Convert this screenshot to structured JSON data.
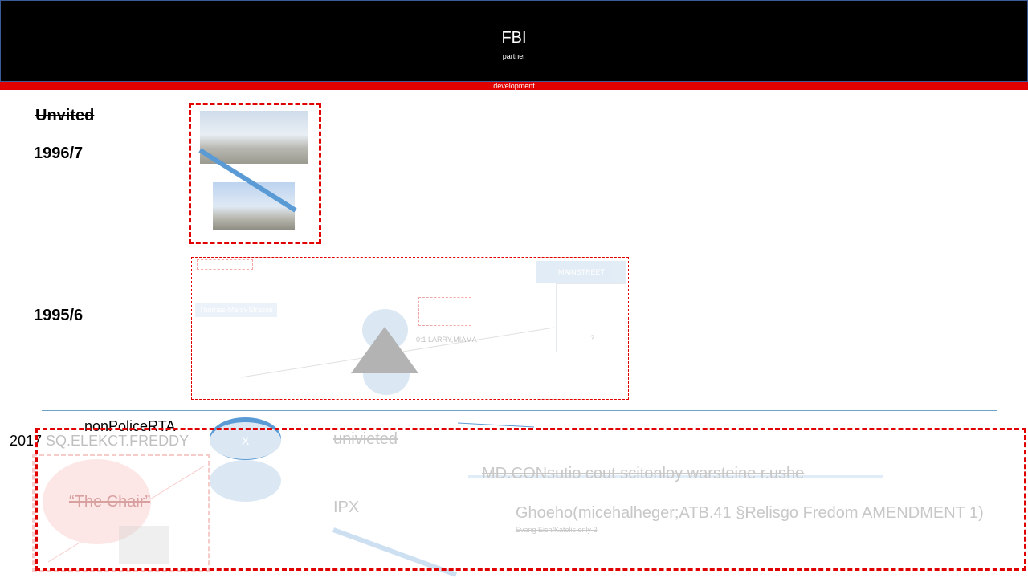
{
  "header": {
    "title": "FBI",
    "subtitle": "partner",
    "bar_label": "development"
  },
  "section1": {
    "label_struck": "Unvited",
    "year": "1996/7"
  },
  "section2": {
    "year": "1995/6",
    "street_label": "Thomas-Mann-Strasse",
    "mainstreet_label": "MAINSTREET",
    "larry_text": "0:1 LARRY,MIAMA",
    "question_mark": "?"
  },
  "section3": {
    "label_top": "nonPoliceRTA",
    "year_freddy": "2017 SQ.ELEKCT.FREDDY",
    "ellipse_x": "X",
    "univieted": "univieted",
    "md_text": "MD.CONsutio cout scitonloy warsteine r.ushe",
    "chair": "“The Chair”",
    "ipx": "IPX",
    "ghoeho": "Ghoeho(micehalheger;ATB.41 §Relisgo Fredom AMENDMENT 1)",
    "evang": "Evang Eich/Katolis only 2"
  },
  "colors": {
    "header_bg": "#000000",
    "accent_red": "#e00000",
    "line_blue": "#5b9bd5",
    "ellipse_blue": "#dbe8f4"
  }
}
